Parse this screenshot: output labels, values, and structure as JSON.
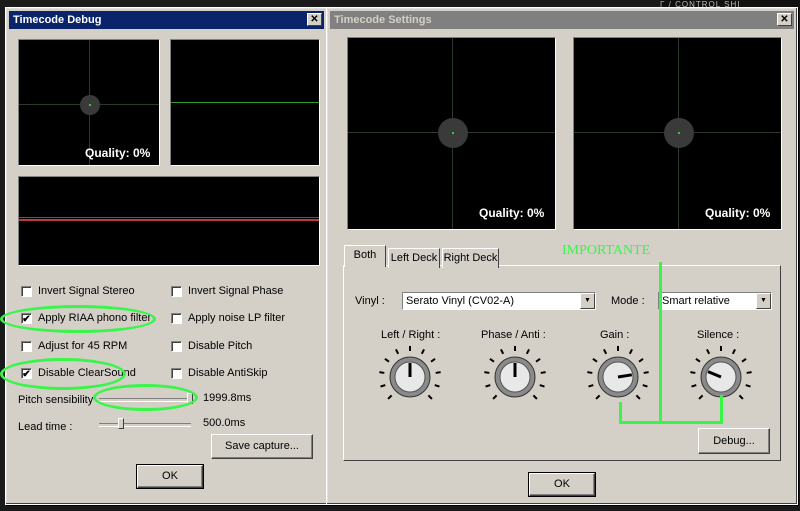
{
  "background": {
    "strip_text": "Γ / CONTROL          SHI"
  },
  "debug_window": {
    "title": "Timecode Debug",
    "close_glyph": "✕",
    "scope_quality": "Quality: 0%",
    "checkboxes": [
      {
        "label": "Invert Signal Stereo",
        "checked": false
      },
      {
        "label": "Invert Signal Phase",
        "checked": false
      },
      {
        "label": "Apply RIAA phono filter",
        "checked": true
      },
      {
        "label": "Apply noise LP filter",
        "checked": false
      },
      {
        "label": "Adjust for 45 RPM",
        "checked": false
      },
      {
        "label": "Disable Pitch",
        "checked": false
      },
      {
        "label": "Disable ClearSound",
        "checked": true
      },
      {
        "label": "Disable AntiSkip",
        "checked": false
      }
    ],
    "pitch_label": "Pitch sensibility",
    "pitch_value": "1999.8ms",
    "lead_label": "Lead time :",
    "lead_value": "500.0ms",
    "save_button": "Save capture...",
    "ok_button": "OK",
    "check_glyph": "✔"
  },
  "settings_window": {
    "title": "Timecode Settings",
    "close_glyph": "✕",
    "quality_left": "Quality: 0%",
    "quality_right": "Quality: 0%",
    "tabs": [
      "Both",
      "Left Deck",
      "Right Deck"
    ],
    "vinyl_label": "Vinyl :",
    "vinyl_value": "Serato Vinyl (CV02-A)",
    "mode_label": "Mode :",
    "mode_value": "Smart relative",
    "knobs": [
      {
        "label": "Left / Right :",
        "value": 0.0
      },
      {
        "label": "Phase / Anti :",
        "value": 0.0
      },
      {
        "label": "Gain :",
        "value": 0.6
      },
      {
        "label": "Silence :",
        "value": -0.5
      }
    ],
    "debug_button": "Debug...",
    "ok_button": "OK",
    "annotation": "IMPORTANTE"
  },
  "colors": {
    "highlight": "#39f54a",
    "title_active": "#0a246a",
    "trace_red": "#c0393b"
  }
}
